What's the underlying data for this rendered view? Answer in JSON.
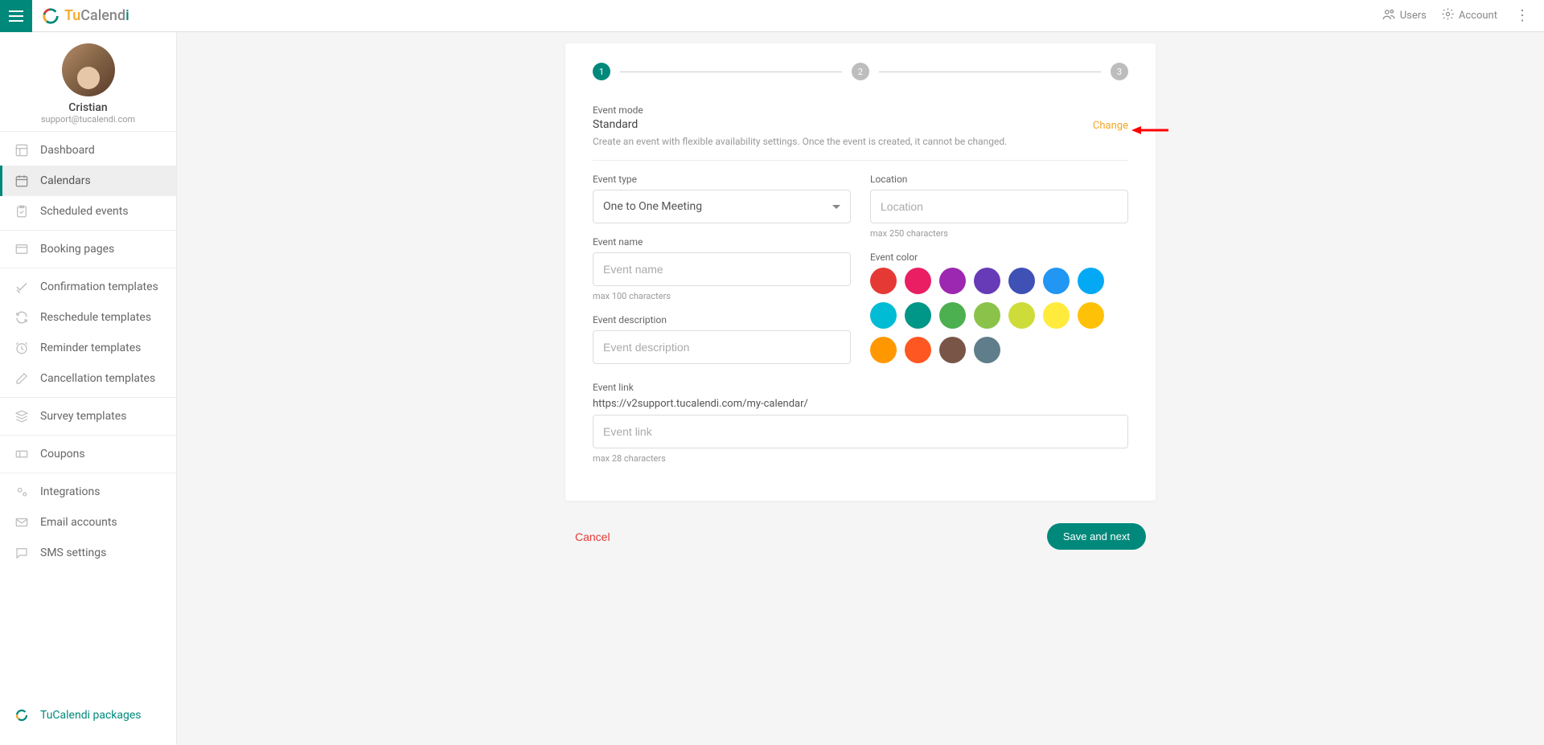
{
  "brand": {
    "part1": "Tu",
    "part2": "Calend",
    "part3": "i"
  },
  "header": {
    "users_label": "Users",
    "account_label": "Account"
  },
  "profile": {
    "name": "Cristian",
    "email": "support@tucalendi.com"
  },
  "nav": {
    "dashboard": "Dashboard",
    "calendars": "Calendars",
    "scheduled": "Scheduled events",
    "booking": "Booking pages",
    "confirm": "Confirmation templates",
    "reschedule": "Reschedule templates",
    "reminder": "Reminder templates",
    "cancellation": "Cancellation templates",
    "survey": "Survey templates",
    "coupons": "Coupons",
    "integrations": "Integrations",
    "email": "Email accounts",
    "sms": "SMS settings",
    "packages": "TuCalendi packages"
  },
  "stepper": {
    "s1": "1",
    "s2": "2",
    "s3": "3"
  },
  "mode": {
    "label": "Event mode",
    "title": "Standard",
    "desc": "Create an event with flexible availability settings. Once the event is created, it cannot be changed.",
    "change": "Change"
  },
  "form": {
    "event_type_label": "Event type",
    "event_type_value": "One to One Meeting",
    "event_name_label": "Event name",
    "event_name_placeholder": "Event name",
    "event_name_hint": "max 100 characters",
    "event_desc_label": "Event description",
    "event_desc_placeholder": "Event description",
    "location_label": "Location",
    "location_placeholder": "Location",
    "location_hint": "max 250 characters",
    "color_label": "Event color",
    "link_label": "Event link",
    "link_prefix": "https://v2support.tucalendi.com/my-calendar/",
    "link_placeholder": "Event link",
    "link_hint": "max 28 characters"
  },
  "colors": [
    "#e53935",
    "#e91e63",
    "#9c27b0",
    "#673ab7",
    "#3f51b5",
    "#2196f3",
    "#03a9f4",
    "#00bcd4",
    "#009688",
    "#4caf50",
    "#8bc34a",
    "#cddc39",
    "#ffeb3b",
    "#ffc107",
    "#ff9800",
    "#ff5722",
    "#795548",
    "#607d8b"
  ],
  "actions": {
    "cancel": "Cancel",
    "save": "Save and next"
  }
}
